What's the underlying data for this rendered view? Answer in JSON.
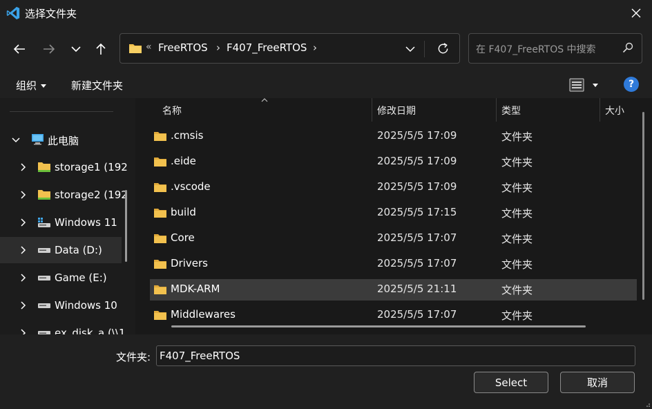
{
  "window": {
    "title": "选择文件夹"
  },
  "nav": {
    "breadcrumb": [
      "FreeRTOS",
      "F407_FreeRTOS"
    ],
    "overflow": "«",
    "search_placeholder": "在 F407_FreeRTOS 中搜索"
  },
  "toolbar": {
    "organize": "组织",
    "new_folder": "新建文件夹"
  },
  "sidebar": {
    "items": [
      {
        "label": "此电脑",
        "icon": "computer-icon"
      },
      {
        "label": "storage1 (192",
        "icon": "network-drive-icon"
      },
      {
        "label": "storage2 (192",
        "icon": "network-drive-icon"
      },
      {
        "label": "Windows 11",
        "icon": "system-drive-icon"
      },
      {
        "label": "Data (D:)",
        "icon": "drive-icon"
      },
      {
        "label": "Game (E:)",
        "icon": "drive-icon"
      },
      {
        "label": "Windows 10",
        "icon": "drive-icon"
      },
      {
        "label": "ex_disk_a (\\\\1",
        "icon": "drive-icon"
      }
    ]
  },
  "columns": {
    "name": "名称",
    "modified": "修改日期",
    "type": "类型",
    "size": "大小"
  },
  "files": [
    {
      "name": ".cmsis",
      "date": "2025/5/5 17:09",
      "type": "文件夹"
    },
    {
      "name": ".eide",
      "date": "2025/5/5 17:09",
      "type": "文件夹"
    },
    {
      "name": ".vscode",
      "date": "2025/5/5 17:09",
      "type": "文件夹"
    },
    {
      "name": "build",
      "date": "2025/5/5 17:15",
      "type": "文件夹"
    },
    {
      "name": "Core",
      "date": "2025/5/5 17:07",
      "type": "文件夹"
    },
    {
      "name": "Drivers",
      "date": "2025/5/5 17:07",
      "type": "文件夹"
    },
    {
      "name": "MDK-ARM",
      "date": "2025/5/5 21:11",
      "type": "文件夹"
    },
    {
      "name": "Middlewares",
      "date": "2025/5/5 17:07",
      "type": "文件夹"
    }
  ],
  "bottom": {
    "folder_label": "文件夹:",
    "folder_value": "F407_FreeRTOS",
    "select_label": "Select",
    "cancel_label": "取消"
  },
  "colors": {
    "folder": "#f2c14e",
    "accent": "#2f7ad9",
    "selected_row": "#3b3b3b"
  }
}
